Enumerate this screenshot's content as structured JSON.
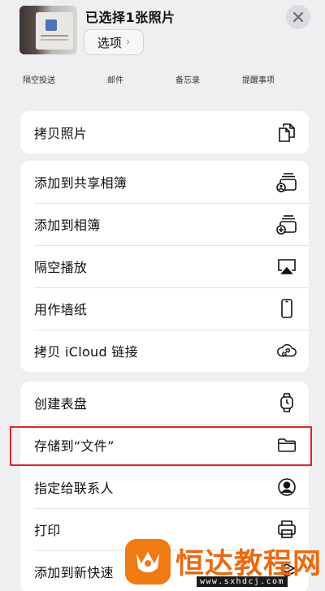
{
  "header": {
    "title": "已选择1张照片",
    "options_label": "选项",
    "options_chevron": "›",
    "close_icon": "close-icon"
  },
  "share_targets": [
    "隔空投送",
    "邮件",
    "备忘录",
    "提醒事项"
  ],
  "groups": [
    {
      "items": [
        {
          "label": "拷贝照片",
          "icon": "copy-icon"
        }
      ]
    },
    {
      "items": [
        {
          "label": "添加到共享相簿",
          "icon": "shared-album-icon"
        },
        {
          "label": "添加到相簿",
          "icon": "add-album-icon"
        },
        {
          "label": "隔空播放",
          "icon": "airplay-icon"
        },
        {
          "label": "用作墙纸",
          "icon": "phone-icon"
        },
        {
          "label": "拷贝 iCloud 链接",
          "icon": "icloud-link-icon"
        }
      ]
    },
    {
      "items": [
        {
          "label": "创建表盘",
          "icon": "watch-icon"
        },
        {
          "label": "存储到“文件”",
          "icon": "folder-icon"
        },
        {
          "label": "指定给联系人",
          "icon": "contact-icon"
        },
        {
          "label": "打印",
          "icon": "printer-icon"
        },
        {
          "label": "添加到新快速",
          "icon": "shortcut-icon"
        }
      ]
    }
  ],
  "watermark": {
    "text": "恒达教程网",
    "url": "www.sxhdcj.com"
  },
  "colors": {
    "background": "#efeff2",
    "highlight": "#d9262e",
    "watermark": "#ec6a11"
  }
}
